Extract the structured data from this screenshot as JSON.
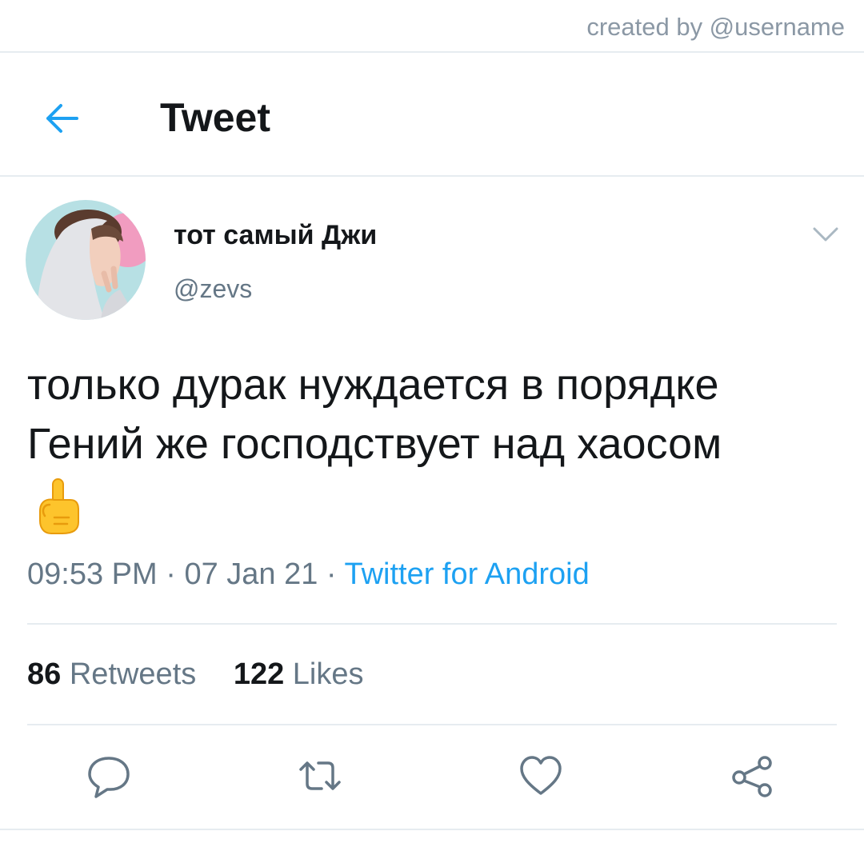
{
  "watermark": "created by @username",
  "header": {
    "title": "Tweet",
    "back_icon": "arrow-left-icon"
  },
  "tweet": {
    "display_name": "тот самый Джи",
    "handle": "@zevs",
    "text_line1": "только дурак нуждается в порядке",
    "text_line2": "Гений же господствует над хаосом",
    "emoji": "☝",
    "time": "09:53 PM",
    "separator": "·",
    "date": "07 Jan 21",
    "source": "Twitter for Android"
  },
  "stats": {
    "retweets_count": "86",
    "retweets_label": "Retweets",
    "likes_count": "122",
    "likes_label": "Likes"
  },
  "actions": [
    "reply-icon",
    "retweet-icon",
    "like-icon",
    "share-icon"
  ],
  "colors": {
    "accent": "#1da1f2",
    "secondary_text": "#657786",
    "divider": "#e6ecf0",
    "primary_text": "#14171a"
  }
}
